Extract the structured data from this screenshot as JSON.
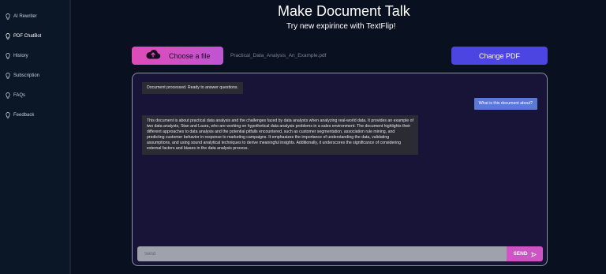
{
  "sidebar": {
    "items": [
      {
        "label": "AI Rewriter",
        "icon": "lightbulb-icon"
      },
      {
        "label": "PDF ChatBot",
        "icon": "lightbulb-icon",
        "active": true
      },
      {
        "label": "History",
        "icon": "lightbulb-icon"
      },
      {
        "label": "Subscription",
        "icon": "lightbulb-icon"
      },
      {
        "label": "FAQs",
        "icon": "lightbulb-icon"
      },
      {
        "label": "Feedback",
        "icon": "lightbulb-icon"
      }
    ]
  },
  "header": {
    "title": "Make Document Talk",
    "subtitle": "Try new expirince with TextFlip!"
  },
  "upload": {
    "choose_label": "Choose a file",
    "file_name": "Practical_Data_Analysis_An_Example.pdf",
    "change_label": "Change PDF"
  },
  "chat": {
    "system_message": "Document processed. Ready to answer questions.",
    "user_message": "What is this document about?",
    "bot_message": "This document is about practical data analysis and the challenges faced by data analysts when analyzing real-world data. It provides an example of two data analysts, Stan and Laura, who are working on hypothetical data analysis problems in a sales environment. The document highlights their different approaches to data analysis and the potential pitfalls encountered, such as customer segmentation, association rule mining, and predicting customer behavior in response to marketing campaigns. It emphasizes the importance of understanding the data, validating assumptions, and using sound analytical techniques to derive meaningful insights. Additionally, it underscores the significance of considering external factors and biases in the data analysis process.",
    "input_placeholder": "Send",
    "send_label": "SEND"
  },
  "colors": {
    "background": "#091120",
    "chat_background": "#171437",
    "choose_gradient_start": "#e04bb7",
    "change_button": "#4c45e2",
    "user_bubble": "#5a78d6",
    "send_button": "#ce54c6"
  }
}
